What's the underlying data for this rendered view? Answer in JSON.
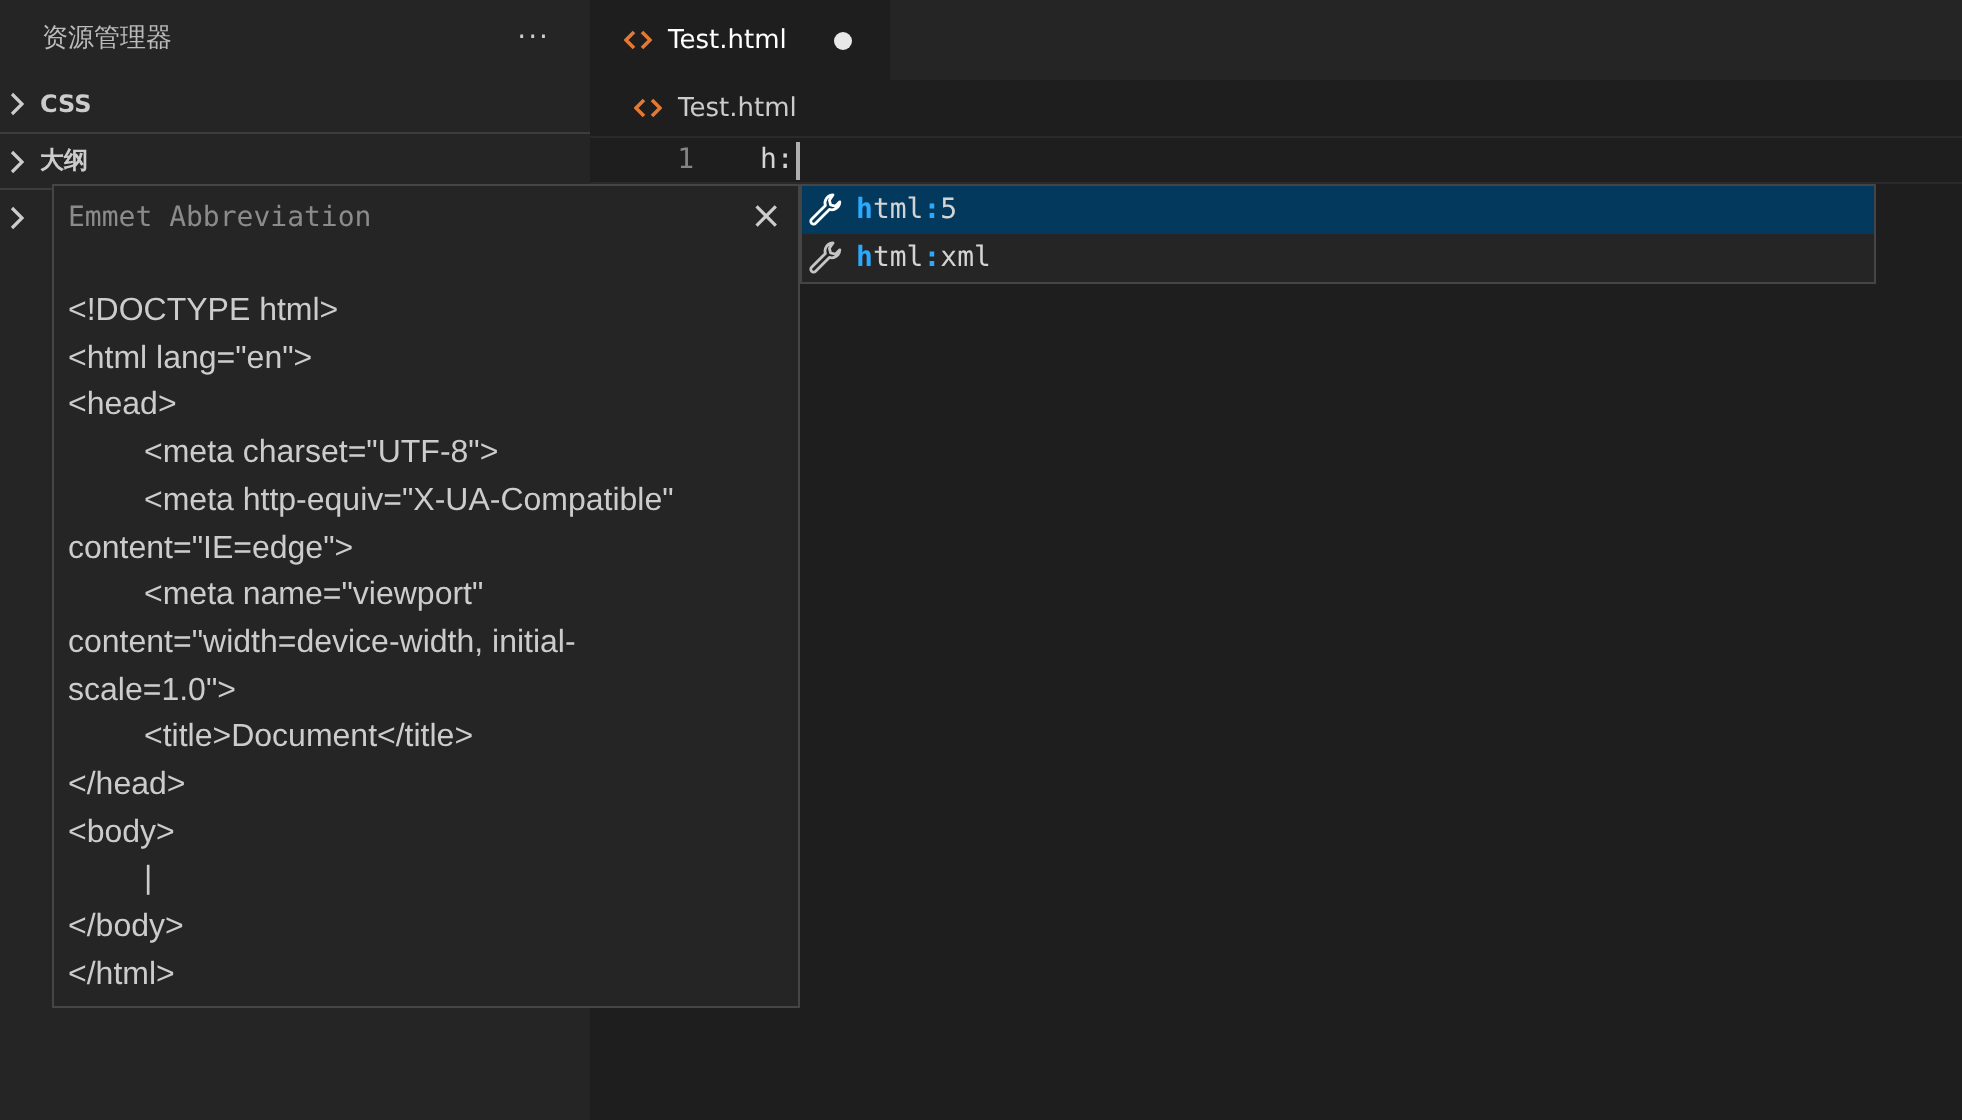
{
  "sidebar": {
    "title": "资源管理器",
    "more": "···",
    "sections": [
      {
        "label": "CSS",
        "expanded": false
      },
      {
        "label": "大纲",
        "expanded": false
      },
      {
        "expanded": false
      }
    ]
  },
  "tabs": [
    {
      "label": "Test.html",
      "selected": true,
      "dirty": true
    }
  ],
  "breadcrumb": {
    "label": "Test.html"
  },
  "editor": {
    "lines": [
      {
        "number": "1",
        "text": "h:"
      }
    ]
  },
  "suggest": {
    "items": [
      {
        "selected": true,
        "parts": [
          {
            "text": "h",
            "matched": true
          },
          {
            "text": "tml",
            "matched": false
          },
          {
            "text": ":",
            "matched": true
          },
          {
            "text": "5",
            "matched": false
          }
        ]
      },
      {
        "selected": false,
        "parts": [
          {
            "text": "h",
            "matched": true
          },
          {
            "text": "tml",
            "matched": false
          },
          {
            "text": ":",
            "matched": true
          },
          {
            "text": "xml",
            "matched": false
          }
        ]
      }
    ]
  },
  "details": {
    "title": "Emmet Abbreviation",
    "close": "×",
    "lines": [
      {
        "text": "<!DOCTYPE html>",
        "indent": false
      },
      {
        "text": "<html lang=\"en\">",
        "indent": false
      },
      {
        "text": "<head>",
        "indent": false
      },
      {
        "text": "<meta charset=\"UTF-8\">",
        "indent": true
      },
      {
        "text": "<meta http-equiv=\"X-UA-Compatible\"",
        "indent": true
      },
      {
        "text": "content=\"IE=edge\">",
        "indent": false
      },
      {
        "text": "<meta name=\"viewport\"",
        "indent": true
      },
      {
        "text": "content=\"width=device-width, initial-",
        "indent": false
      },
      {
        "text": "scale=1.0\">",
        "indent": false
      },
      {
        "text": "<title>Document</title>",
        "indent": true
      },
      {
        "text": "</head>",
        "indent": false
      },
      {
        "text": "<body>",
        "indent": false
      },
      {
        "text": "|",
        "indent": true
      },
      {
        "text": "</body>",
        "indent": false
      },
      {
        "text": "</html>",
        "indent": false
      }
    ]
  }
}
